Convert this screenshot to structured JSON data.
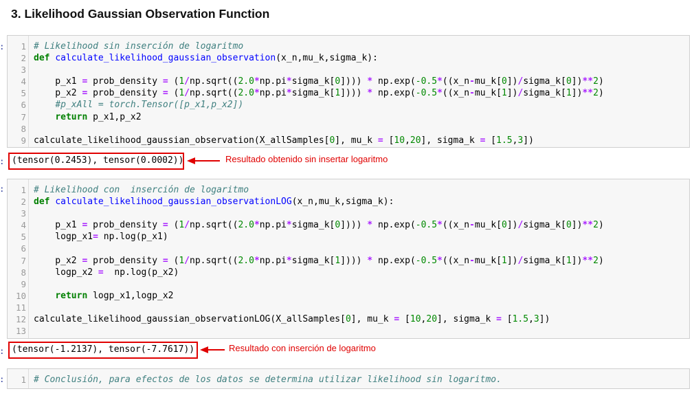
{
  "heading": "3. Likelihood Gaussian Observation Function",
  "prompt_glyph": ":",
  "cells": [
    {
      "lines": [
        {
          "n": "1",
          "tokens": [
            {
              "t": "# Likelihood sin inserción de logaritmo",
              "c": "c"
            }
          ]
        },
        {
          "n": "2",
          "tokens": [
            {
              "t": "def",
              "c": "k"
            },
            {
              "t": " "
            },
            {
              "t": "calculate_likelihood_gaussian_observation",
              "c": "f"
            },
            {
              "t": "(x_n,mu_k,sigma_k):"
            }
          ]
        },
        {
          "n": "3",
          "tokens": []
        },
        {
          "n": "4",
          "tokens": [
            {
              "t": "    p_x1 "
            },
            {
              "t": "=",
              "c": "o"
            },
            {
              "t": " prob_density "
            },
            {
              "t": "=",
              "c": "o"
            },
            {
              "t": " ("
            },
            {
              "t": "1",
              "c": "n"
            },
            {
              "t": "/",
              "c": "o"
            },
            {
              "t": "np.sqrt(("
            },
            {
              "t": "2.0",
              "c": "n"
            },
            {
              "t": "*",
              "c": "o"
            },
            {
              "t": "np.pi"
            },
            {
              "t": "*",
              "c": "o"
            },
            {
              "t": "sigma_k["
            },
            {
              "t": "0",
              "c": "n"
            },
            {
              "t": "]))) "
            },
            {
              "t": "*",
              "c": "o"
            },
            {
              "t": " np.exp("
            },
            {
              "t": "-0.5",
              "c": "n"
            },
            {
              "t": "*",
              "c": "o"
            },
            {
              "t": "((x_n"
            },
            {
              "t": "-",
              "c": "o"
            },
            {
              "t": "mu_k["
            },
            {
              "t": "0",
              "c": "n"
            },
            {
              "t": "])"
            },
            {
              "t": "/",
              "c": "o"
            },
            {
              "t": "sigma_k["
            },
            {
              "t": "0",
              "c": "n"
            },
            {
              "t": "])"
            },
            {
              "t": "**",
              "c": "o"
            },
            {
              "t": "2",
              "c": "n"
            },
            {
              "t": ")"
            }
          ]
        },
        {
          "n": "5",
          "tokens": [
            {
              "t": "    p_x2 "
            },
            {
              "t": "=",
              "c": "o"
            },
            {
              "t": " prob_density "
            },
            {
              "t": "=",
              "c": "o"
            },
            {
              "t": " ("
            },
            {
              "t": "1",
              "c": "n"
            },
            {
              "t": "/",
              "c": "o"
            },
            {
              "t": "np.sqrt(("
            },
            {
              "t": "2.0",
              "c": "n"
            },
            {
              "t": "*",
              "c": "o"
            },
            {
              "t": "np.pi"
            },
            {
              "t": "*",
              "c": "o"
            },
            {
              "t": "sigma_k["
            },
            {
              "t": "1",
              "c": "n"
            },
            {
              "t": "]))) "
            },
            {
              "t": "*",
              "c": "o"
            },
            {
              "t": " np.exp("
            },
            {
              "t": "-0.5",
              "c": "n"
            },
            {
              "t": "*",
              "c": "o"
            },
            {
              "t": "((x_n"
            },
            {
              "t": "-",
              "c": "o"
            },
            {
              "t": "mu_k["
            },
            {
              "t": "1",
              "c": "n"
            },
            {
              "t": "])"
            },
            {
              "t": "/",
              "c": "o"
            },
            {
              "t": "sigma_k["
            },
            {
              "t": "1",
              "c": "n"
            },
            {
              "t": "])"
            },
            {
              "t": "**",
              "c": "o"
            },
            {
              "t": "2",
              "c": "n"
            },
            {
              "t": ")"
            }
          ]
        },
        {
          "n": "6",
          "tokens": [
            {
              "t": "    "
            },
            {
              "t": "#p_xAll = torch.Tensor([p_x1,p_x2])",
              "c": "c"
            }
          ]
        },
        {
          "n": "7",
          "tokens": [
            {
              "t": "    "
            },
            {
              "t": "return",
              "c": "k"
            },
            {
              "t": " p_x1,p_x2"
            }
          ]
        },
        {
          "n": "8",
          "tokens": []
        },
        {
          "n": "9",
          "tokens": [
            {
              "t": "calculate_likelihood_gaussian_observation(X_allSamples["
            },
            {
              "t": "0",
              "c": "n"
            },
            {
              "t": "], mu_k "
            },
            {
              "t": "=",
              "c": "o"
            },
            {
              "t": " ["
            },
            {
              "t": "10",
              "c": "n"
            },
            {
              "t": ","
            },
            {
              "t": "20",
              "c": "n"
            },
            {
              "t": "], sigma_k "
            },
            {
              "t": "=",
              "c": "o"
            },
            {
              "t": " ["
            },
            {
              "t": "1.5",
              "c": "n"
            },
            {
              "t": ","
            },
            {
              "t": "3",
              "c": "n"
            },
            {
              "t": "])"
            }
          ]
        }
      ]
    },
    {
      "lines": [
        {
          "n": "1",
          "tokens": [
            {
              "t": "# Likelihood con  inserción de logaritmo",
              "c": "c"
            }
          ]
        },
        {
          "n": "2",
          "tokens": [
            {
              "t": "def",
              "c": "k"
            },
            {
              "t": " "
            },
            {
              "t": "calculate_likelihood_gaussian_observationLOG",
              "c": "f"
            },
            {
              "t": "(x_n,mu_k,sigma_k):"
            }
          ]
        },
        {
          "n": "3",
          "tokens": []
        },
        {
          "n": "4",
          "tokens": [
            {
              "t": "    p_x1 "
            },
            {
              "t": "=",
              "c": "o"
            },
            {
              "t": " prob_density "
            },
            {
              "t": "=",
              "c": "o"
            },
            {
              "t": " ("
            },
            {
              "t": "1",
              "c": "n"
            },
            {
              "t": "/",
              "c": "o"
            },
            {
              "t": "np.sqrt(("
            },
            {
              "t": "2.0",
              "c": "n"
            },
            {
              "t": "*",
              "c": "o"
            },
            {
              "t": "np.pi"
            },
            {
              "t": "*",
              "c": "o"
            },
            {
              "t": "sigma_k["
            },
            {
              "t": "0",
              "c": "n"
            },
            {
              "t": "]))) "
            },
            {
              "t": "*",
              "c": "o"
            },
            {
              "t": " np.exp("
            },
            {
              "t": "-0.5",
              "c": "n"
            },
            {
              "t": "*",
              "c": "o"
            },
            {
              "t": "((x_n"
            },
            {
              "t": "-",
              "c": "o"
            },
            {
              "t": "mu_k["
            },
            {
              "t": "0",
              "c": "n"
            },
            {
              "t": "])"
            },
            {
              "t": "/",
              "c": "o"
            },
            {
              "t": "sigma_k["
            },
            {
              "t": "0",
              "c": "n"
            },
            {
              "t": "])"
            },
            {
              "t": "**",
              "c": "o"
            },
            {
              "t": "2",
              "c": "n"
            },
            {
              "t": ")"
            }
          ]
        },
        {
          "n": "5",
          "tokens": [
            {
              "t": "    logp_x1"
            },
            {
              "t": "=",
              "c": "o"
            },
            {
              "t": " np.log(p_x1)"
            }
          ]
        },
        {
          "n": "6",
          "tokens": []
        },
        {
          "n": "7",
          "tokens": [
            {
              "t": "    p_x2 "
            },
            {
              "t": "=",
              "c": "o"
            },
            {
              "t": " prob_density "
            },
            {
              "t": "=",
              "c": "o"
            },
            {
              "t": " ("
            },
            {
              "t": "1",
              "c": "n"
            },
            {
              "t": "/",
              "c": "o"
            },
            {
              "t": "np.sqrt(("
            },
            {
              "t": "2.0",
              "c": "n"
            },
            {
              "t": "*",
              "c": "o"
            },
            {
              "t": "np.pi"
            },
            {
              "t": "*",
              "c": "o"
            },
            {
              "t": "sigma_k["
            },
            {
              "t": "1",
              "c": "n"
            },
            {
              "t": "]))) "
            },
            {
              "t": "*",
              "c": "o"
            },
            {
              "t": " np.exp("
            },
            {
              "t": "-0.5",
              "c": "n"
            },
            {
              "t": "*",
              "c": "o"
            },
            {
              "t": "((x_n"
            },
            {
              "t": "-",
              "c": "o"
            },
            {
              "t": "mu_k["
            },
            {
              "t": "1",
              "c": "n"
            },
            {
              "t": "])"
            },
            {
              "t": "/",
              "c": "o"
            },
            {
              "t": "sigma_k["
            },
            {
              "t": "1",
              "c": "n"
            },
            {
              "t": "])"
            },
            {
              "t": "**",
              "c": "o"
            },
            {
              "t": "2",
              "c": "n"
            },
            {
              "t": ")"
            }
          ]
        },
        {
          "n": "8",
          "tokens": [
            {
              "t": "    logp_x2 "
            },
            {
              "t": "=",
              "c": "o"
            },
            {
              "t": "  np.log(p_x2)"
            }
          ]
        },
        {
          "n": "9",
          "tokens": []
        },
        {
          "n": "10",
          "tokens": [
            {
              "t": "    "
            },
            {
              "t": "return",
              "c": "k"
            },
            {
              "t": " logp_x1,logp_x2"
            }
          ]
        },
        {
          "n": "11",
          "tokens": []
        },
        {
          "n": "12",
          "tokens": [
            {
              "t": "calculate_likelihood_gaussian_observationLOG(X_allSamples["
            },
            {
              "t": "0",
              "c": "n"
            },
            {
              "t": "], mu_k "
            },
            {
              "t": "=",
              "c": "o"
            },
            {
              "t": " ["
            },
            {
              "t": "10",
              "c": "n"
            },
            {
              "t": ","
            },
            {
              "t": "20",
              "c": "n"
            },
            {
              "t": "], sigma_k "
            },
            {
              "t": "=",
              "c": "o"
            },
            {
              "t": " ["
            },
            {
              "t": "1.5",
              "c": "n"
            },
            {
              "t": ","
            },
            {
              "t": "3",
              "c": "n"
            },
            {
              "t": "])"
            }
          ]
        },
        {
          "n": "13",
          "tokens": []
        }
      ]
    },
    {
      "lines": [
        {
          "n": "1",
          "tokens": [
            {
              "t": "# Conclusión, para efectos de los datos se determina utilizar likelihood sin logaritmo.",
              "c": "c"
            }
          ]
        }
      ]
    }
  ],
  "outputs": [
    {
      "text": "(tensor(0.2453), tensor(0.0002))",
      "annotation": "Resultado obtenido sin insertar logaritmo"
    },
    {
      "text": "(tensor(-1.2137), tensor(-7.7617))",
      "annotation": "Resultado con inserción de logaritmo"
    }
  ],
  "colors": {
    "annotation_red": "#e00000",
    "comment": "#408080",
    "keyword": "#008000",
    "function": "#0000ff",
    "operator": "#aa22ff",
    "number": "#008800"
  }
}
